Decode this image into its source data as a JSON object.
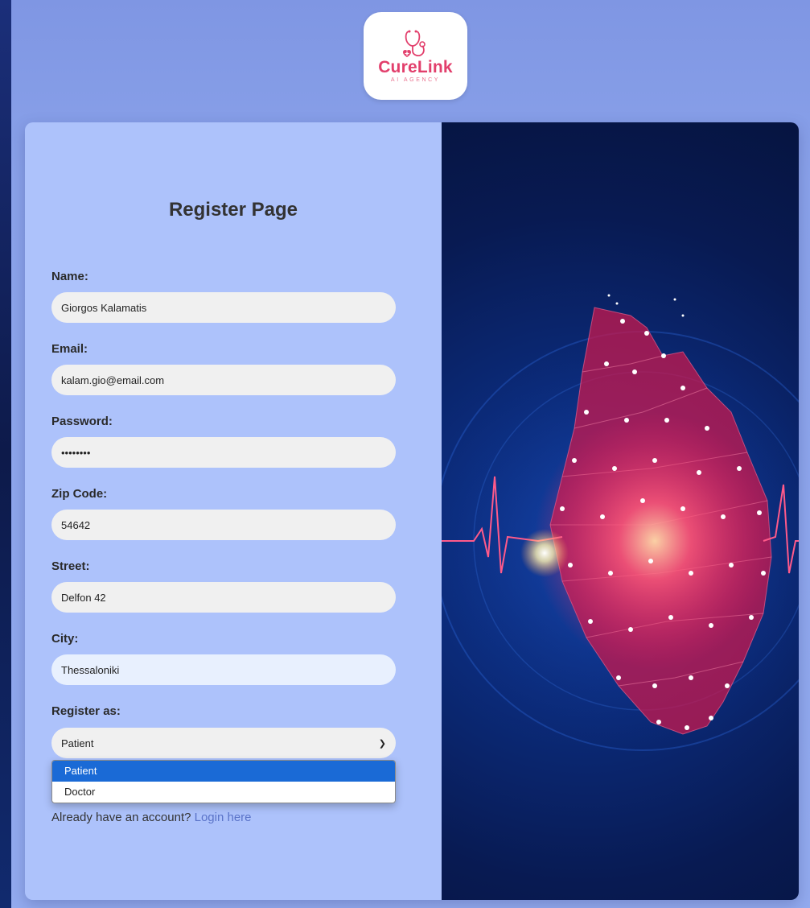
{
  "brand": {
    "name": "CureLink",
    "tagline": "AI AGENCY"
  },
  "form": {
    "title": "Register Page",
    "fields": {
      "name": {
        "label": "Name:",
        "value": "Giorgos Kalamatis"
      },
      "email": {
        "label": "Email:",
        "value": "kalam.gio@email.com"
      },
      "password": {
        "label": "Password:",
        "value": "••••••••"
      },
      "zip": {
        "label": "Zip Code:",
        "value": "54642"
      },
      "street": {
        "label": "Street:",
        "value": "Delfon 42"
      },
      "city": {
        "label": "City:",
        "value": "Thessaloniki"
      }
    },
    "role": {
      "label": "Register as:",
      "selected": "Patient",
      "options": [
        "Patient",
        "Doctor"
      ]
    },
    "login": {
      "prompt": "Already have an account?",
      "link": "Login here"
    }
  },
  "icons": {
    "logo": "stethoscope-heart-icon",
    "select_chevron": "chevron-down-icon"
  },
  "colors": {
    "brand": "#e23f6c",
    "form_panel": "#adc2fb",
    "selected_option": "#1a6ad6",
    "link": "#5a73c8"
  }
}
